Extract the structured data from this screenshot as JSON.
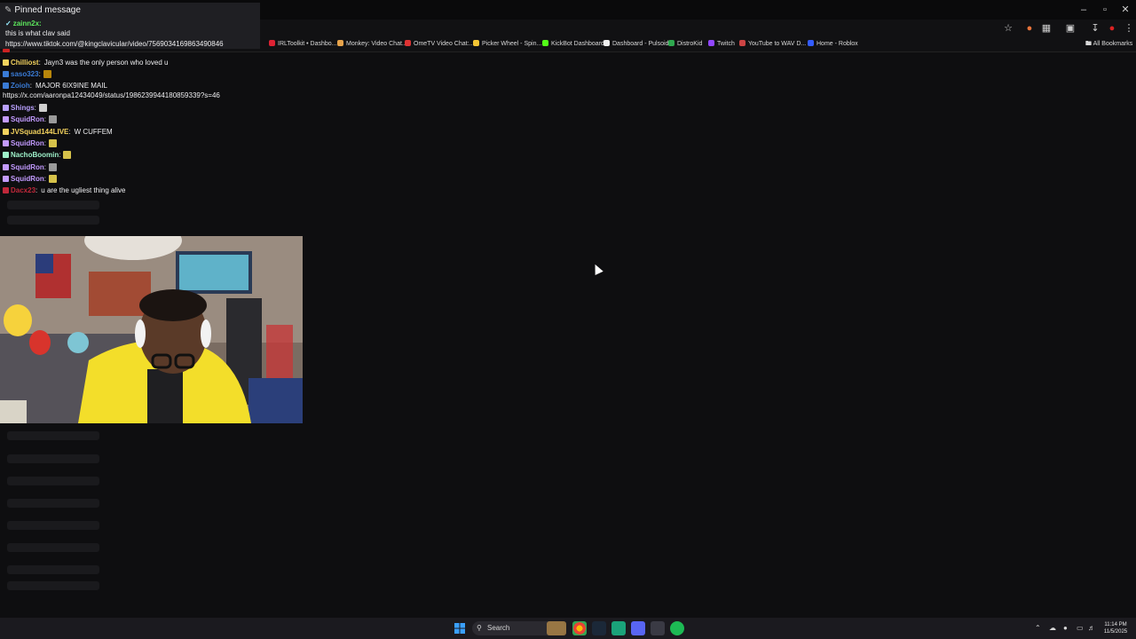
{
  "pinned": {
    "header": "Pinned message",
    "user": "zainn2x:",
    "text": "this is what clav said",
    "link": "https://www.tiktok.com/@kingclavicular/video/7569034169863490846"
  },
  "bookmarks": [
    {
      "label": "IRLToolkit • Dashbo...",
      "color": "#d23"
    },
    {
      "label": "Monkey: Video Chat...",
      "color": "#e6a34b"
    },
    {
      "label": "OmeTV Video Chat:...",
      "color": "#d33"
    },
    {
      "label": "Picker Wheel - Spin...",
      "color": "#f4c534"
    },
    {
      "label": "KickBot Dashboard",
      "color": "#53fc18"
    },
    {
      "label": "Dashboard - Pulsoid",
      "color": "#eee"
    },
    {
      "label": "DistroKid",
      "color": "#2fa84f"
    },
    {
      "label": "Twitch",
      "color": "#9146ff"
    },
    {
      "label": "YouTube to WAV D...",
      "color": "#c44"
    },
    {
      "label": "Home - Roblox",
      "color": "#335cff"
    }
  ],
  "all_bookmarks": "All Bookmarks",
  "chat": [
    {
      "user": "Chilliost",
      "sep": ":",
      "msg": "Jayn3 was the only person who loved u",
      "color": "#f4d35e"
    },
    {
      "user": "saso323",
      "sep": ":",
      "msg": "",
      "color": "#3a7bd5"
    },
    {
      "user": "Zoioh",
      "sep": ":",
      "msg": "MAJOR 6IX9INE MAIL",
      "color": "#3a7bd5"
    },
    {
      "user": "",
      "sep": "",
      "msg": "https://x.com/aaronpa12434049/status/1986239944180859339?s=46",
      "color": "#efeff1"
    },
    {
      "user": "Shings",
      "sep": ":",
      "msg": "",
      "color": "#b9a0ff"
    },
    {
      "user": "SquidRon",
      "sep": ":",
      "msg": "",
      "color": "#c39bff"
    },
    {
      "user": "JVSquad144LIVE",
      "sep": ":",
      "msg": "W CUFFEM",
      "color": "#f4d35e"
    },
    {
      "user": "SquidRon",
      "sep": ":",
      "msg": "",
      "color": "#c39bff"
    },
    {
      "user": "NachoBoomin",
      "sep": ":",
      "msg": "",
      "color": "#9ef0c9"
    },
    {
      "user": "SquidRon",
      "sep": ":",
      "msg": "",
      "color": "#c39bff"
    },
    {
      "user": "SquidRon",
      "sep": ":",
      "msg": "",
      "color": "#c39bff"
    },
    {
      "user": "Dacx23",
      "sep": ":",
      "msg": "u are the ugliest thing alive",
      "color": "#c0283a"
    }
  ],
  "taskbar": {
    "search_label": "Search",
    "time": "11:14 PM",
    "date": "11/5/2025"
  },
  "icons": {
    "minimize": "minimize-icon",
    "maximize": "maximize-icon",
    "close": "close-icon",
    "star": "star-icon",
    "windows": "windows-logo-icon"
  }
}
